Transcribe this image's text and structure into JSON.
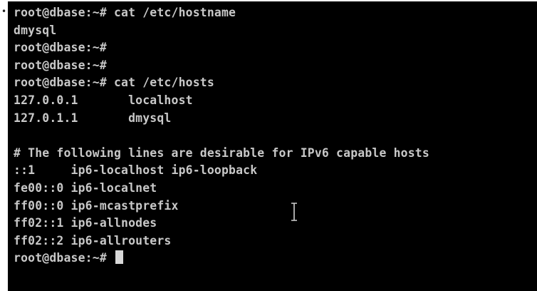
{
  "bullet": "•",
  "terminal": {
    "colors": {
      "background": "#000000",
      "foreground": "#c8c8c8",
      "cursor": "#d8d8d8"
    },
    "lines": [
      "root@dbase:~# cat /etc/hostname",
      "dmysql",
      "root@dbase:~#",
      "root@dbase:~#",
      "root@dbase:~# cat /etc/hosts",
      "127.0.0.1       localhost",
      "127.0.1.1       dmysql",
      "",
      "# The following lines are desirable for IPv6 capable hosts",
      "::1     ip6-localhost ip6-loopback",
      "fe00::0 ip6-localnet",
      "ff00::0 ip6-mcastprefix",
      "ff02::1 ip6-allnodes",
      "ff02::2 ip6-allrouters"
    ],
    "prompt": "root@dbase:~# ",
    "mouse_pointer_icon": "text-cursor-ibeam-icon"
  }
}
